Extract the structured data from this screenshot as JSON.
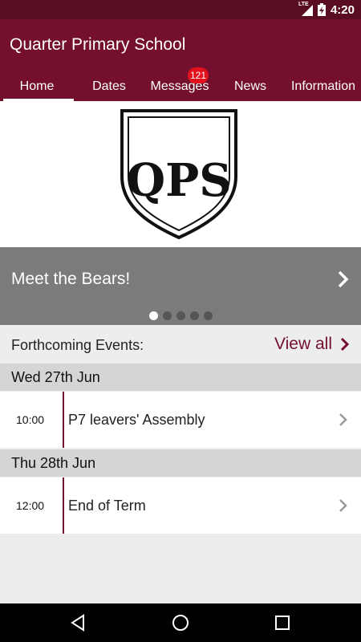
{
  "status_bar": {
    "network": "LTE",
    "time": "4:20"
  },
  "app": {
    "title": "Quarter Primary School",
    "accent": "#74102d"
  },
  "tabs": [
    {
      "label": "Home",
      "active": true
    },
    {
      "label": "Dates"
    },
    {
      "label": "Messages",
      "badge": "121"
    },
    {
      "label": "News"
    },
    {
      "label": "Information"
    }
  ],
  "logo": {
    "text": "QPS"
  },
  "carousel": {
    "title": "Meet the Bears!",
    "slide_count": 5,
    "active_slide": 1
  },
  "events": {
    "heading": "Forthcoming Events:",
    "view_all": "View all",
    "days": [
      {
        "date": "Wed 27th Jun",
        "items": [
          {
            "time": "10:00",
            "title": "P7 leavers' Assembly"
          }
        ]
      },
      {
        "date": "Thu 28th Jun",
        "items": [
          {
            "time": "12:00",
            "title": "End of Term"
          }
        ]
      }
    ]
  },
  "nav": {
    "icons": [
      "back-icon",
      "home-icon",
      "recents-icon"
    ]
  }
}
